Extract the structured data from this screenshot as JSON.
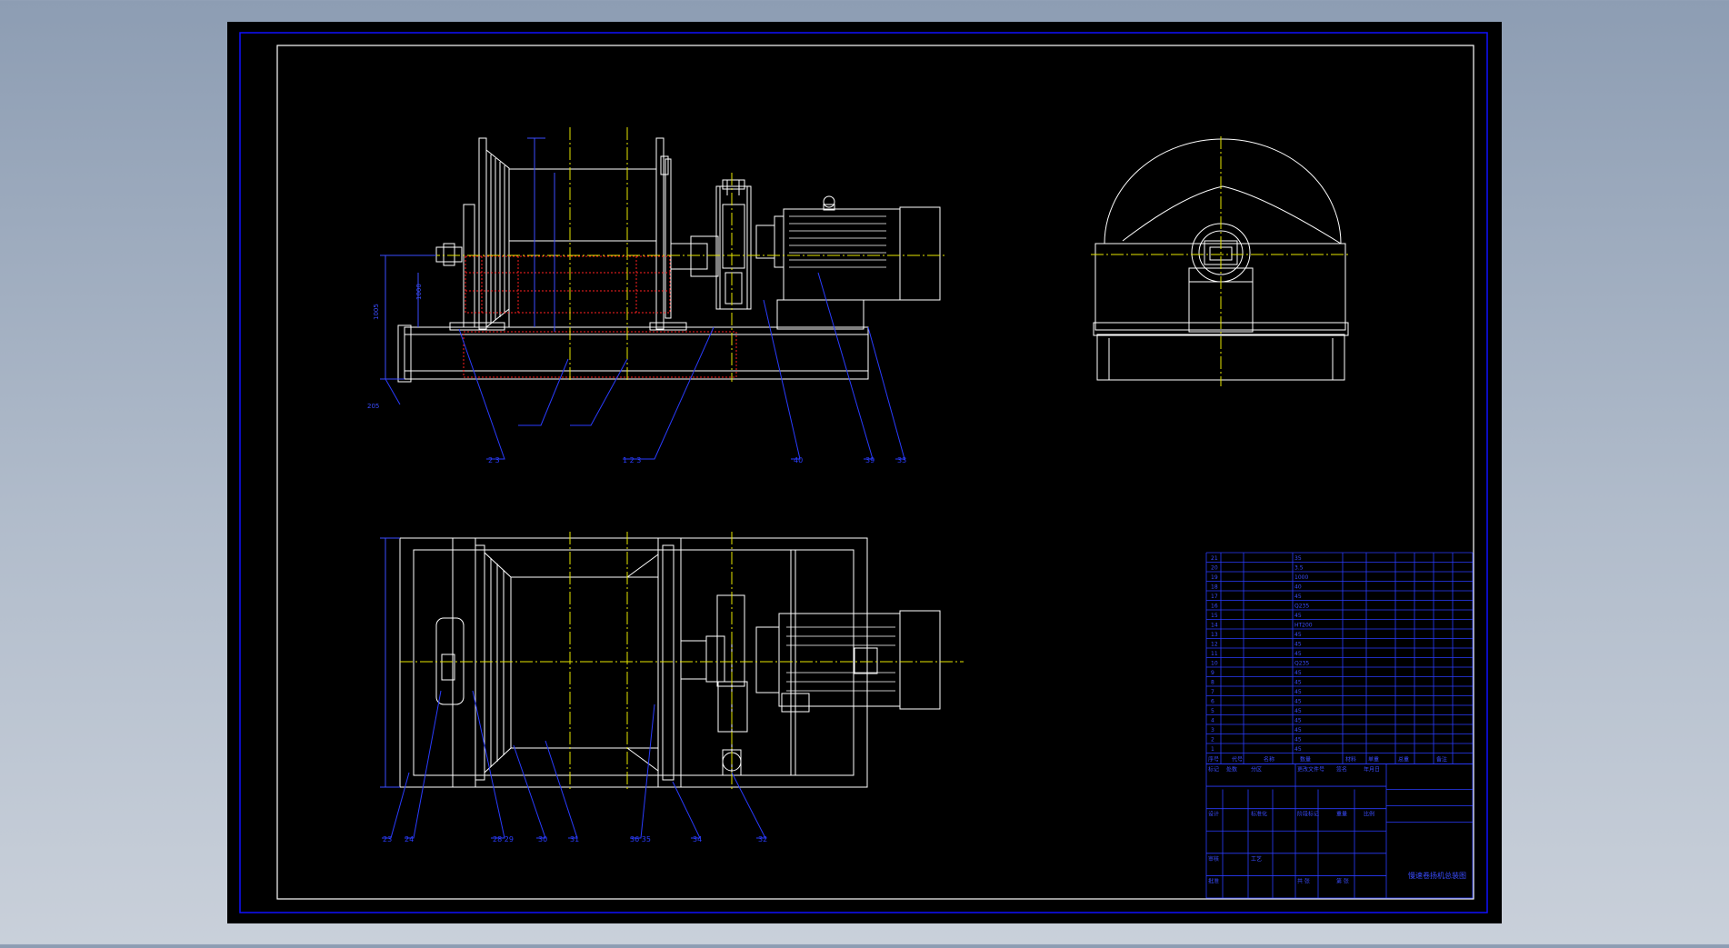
{
  "drawing": {
    "background": "#000000",
    "colors": {
      "geometry": "#ffffff",
      "frame": "#1010ff",
      "centerline": "#e6e600",
      "hidden": "#ff2020",
      "dimension": "#3a4cff",
      "callout": "#2a3cff"
    },
    "front_view": {
      "callouts": [
        "2 3",
        "1 2 3",
        "40",
        "39",
        "33"
      ],
      "left_labels": [
        "205",
        "1005",
        "1000"
      ]
    },
    "top_view": {
      "callouts": [
        "23",
        "24",
        "28 29",
        "30",
        "31",
        "36 35",
        "34",
        "32"
      ]
    }
  },
  "title_block": {
    "header": [
      "序号",
      "代号",
      "名称",
      "数量",
      "材料",
      "单重",
      "总重",
      "备注"
    ],
    "rows": [
      "35",
      "3.5",
      "1000",
      "40",
      "45",
      "Q235",
      "45",
      "HT200",
      "45",
      "45",
      "45",
      "Q235",
      "45",
      "45",
      "45",
      "45",
      "45",
      "45",
      "45",
      "45",
      "45"
    ],
    "labels": [
      "标记",
      "处数",
      "分区",
      "更改文件号",
      "签名",
      "年月日",
      "设计",
      "标准化",
      "阶段标记",
      "重量",
      "比例",
      "审核",
      "工艺",
      "批准",
      "共 张",
      "第 张"
    ],
    "drawing_name": "慢速卷扬机总装图"
  }
}
